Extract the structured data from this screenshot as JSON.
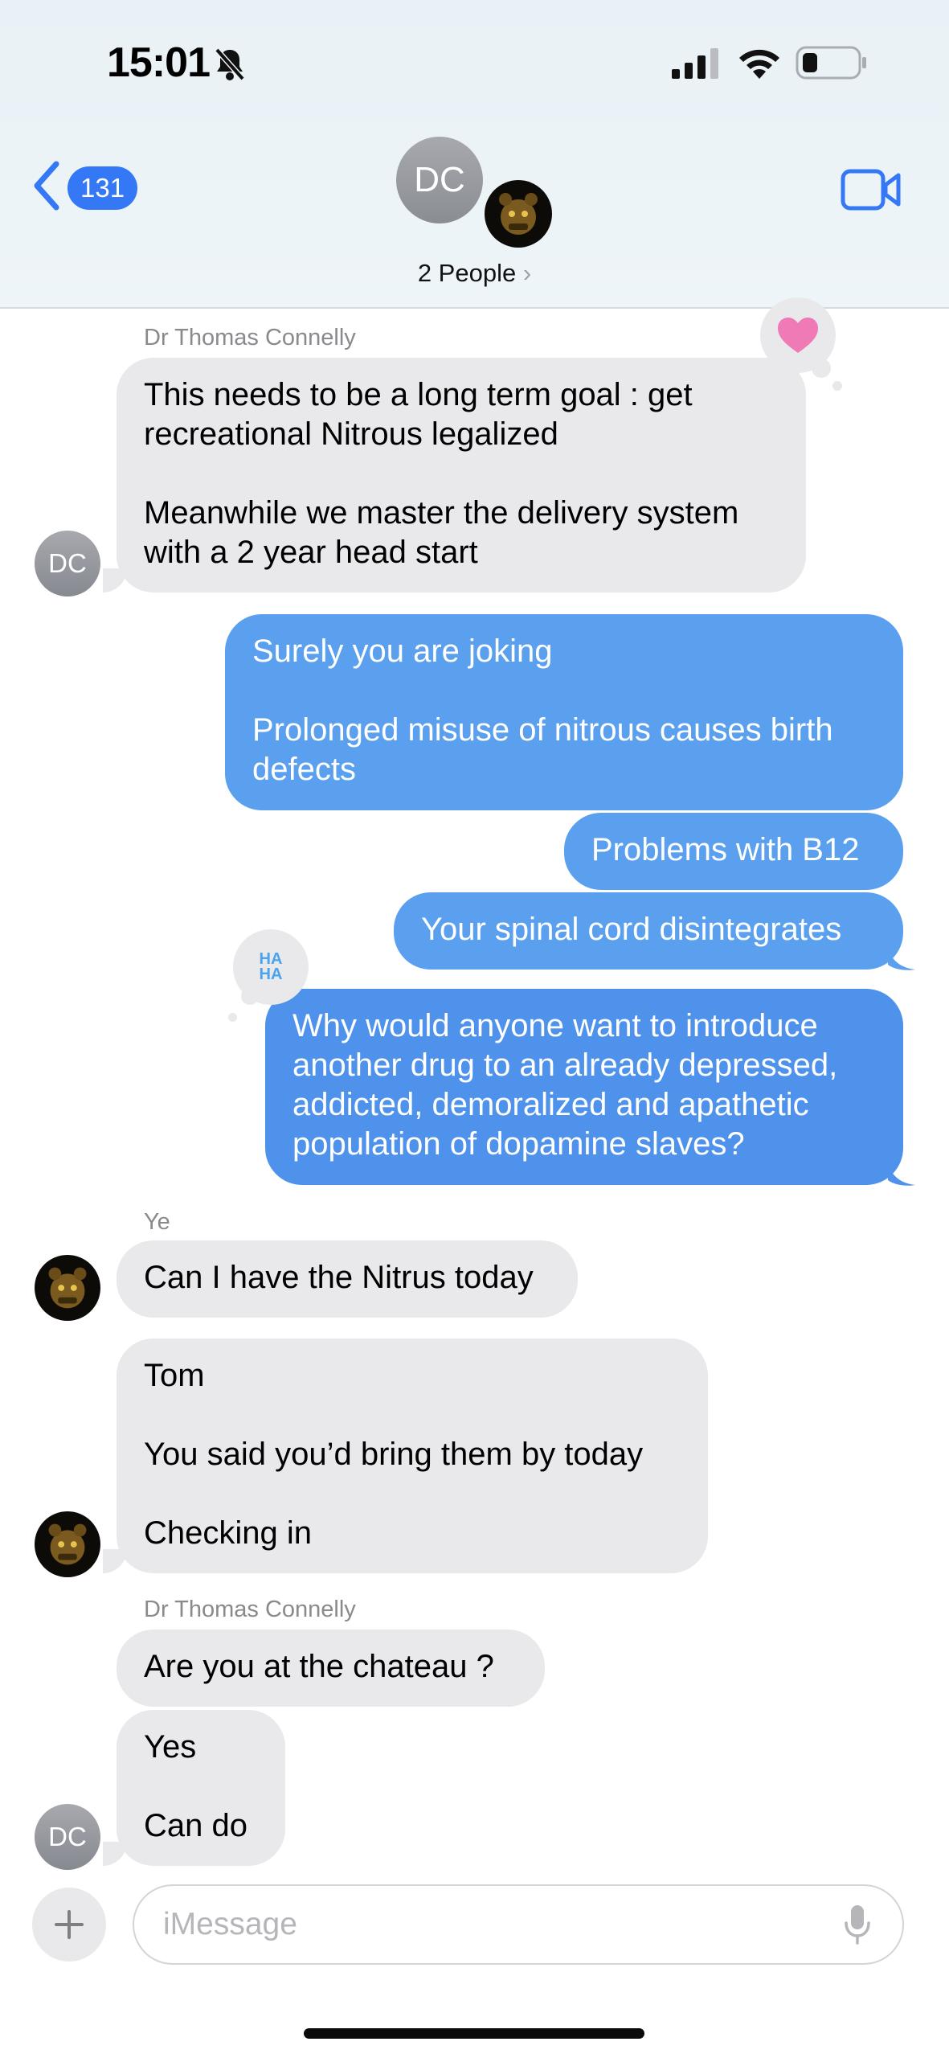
{
  "status_bar": {
    "time": "15:01"
  },
  "header": {
    "back_count": "131",
    "group_initials": "DC",
    "people_label": "2 People",
    "people_chevron": "›"
  },
  "colors": {
    "accent": "#3478f6",
    "outgoing_bubble": "#5aa0ee",
    "incoming_bubble": "#e9e9eb"
  },
  "icons": [
    "bell-slash-icon",
    "signal-icon",
    "wifi-icon",
    "battery-icon",
    "chevron-left-icon",
    "video-camera-icon",
    "heart-tapback-icon",
    "haha-tapback-icon",
    "plus-icon",
    "microphone-icon"
  ],
  "messages": [
    {
      "sender": "Dr Thomas Connelly",
      "direction": "in",
      "text": "This needs to be a long term goal : get recreational Nitrous legalized\n\nMeanwhile we master the delivery system with a 2 year head start",
      "tapback": "heart"
    },
    {
      "direction": "out",
      "text": "Surely you are joking\n\nProlonged misuse of nitrous causes birth defects"
    },
    {
      "direction": "out",
      "text": "Problems with B12"
    },
    {
      "direction": "out",
      "text": "Your spinal cord disintegrates"
    },
    {
      "direction": "out",
      "text": "Why would anyone want to introduce another drug to an already depressed, addicted, demoralized and apathetic population of dopamine slaves?",
      "tapback": "haha"
    },
    {
      "sender": "Ye",
      "direction": "in",
      "text": "Can I have the Nitrus today"
    },
    {
      "direction": "in",
      "text": "Tom\n\nYou said you’d bring them by today\n\nChecking in"
    },
    {
      "sender": "Dr Thomas Connelly",
      "direction": "in",
      "text": "Are you at the chateau ?"
    },
    {
      "direction": "in",
      "text": "Yes\n\nCan do"
    }
  ],
  "avatars": {
    "dc_initials": "DC"
  },
  "tapback_haha_text": "HA\nHA",
  "composer": {
    "placeholder": "iMessage"
  }
}
